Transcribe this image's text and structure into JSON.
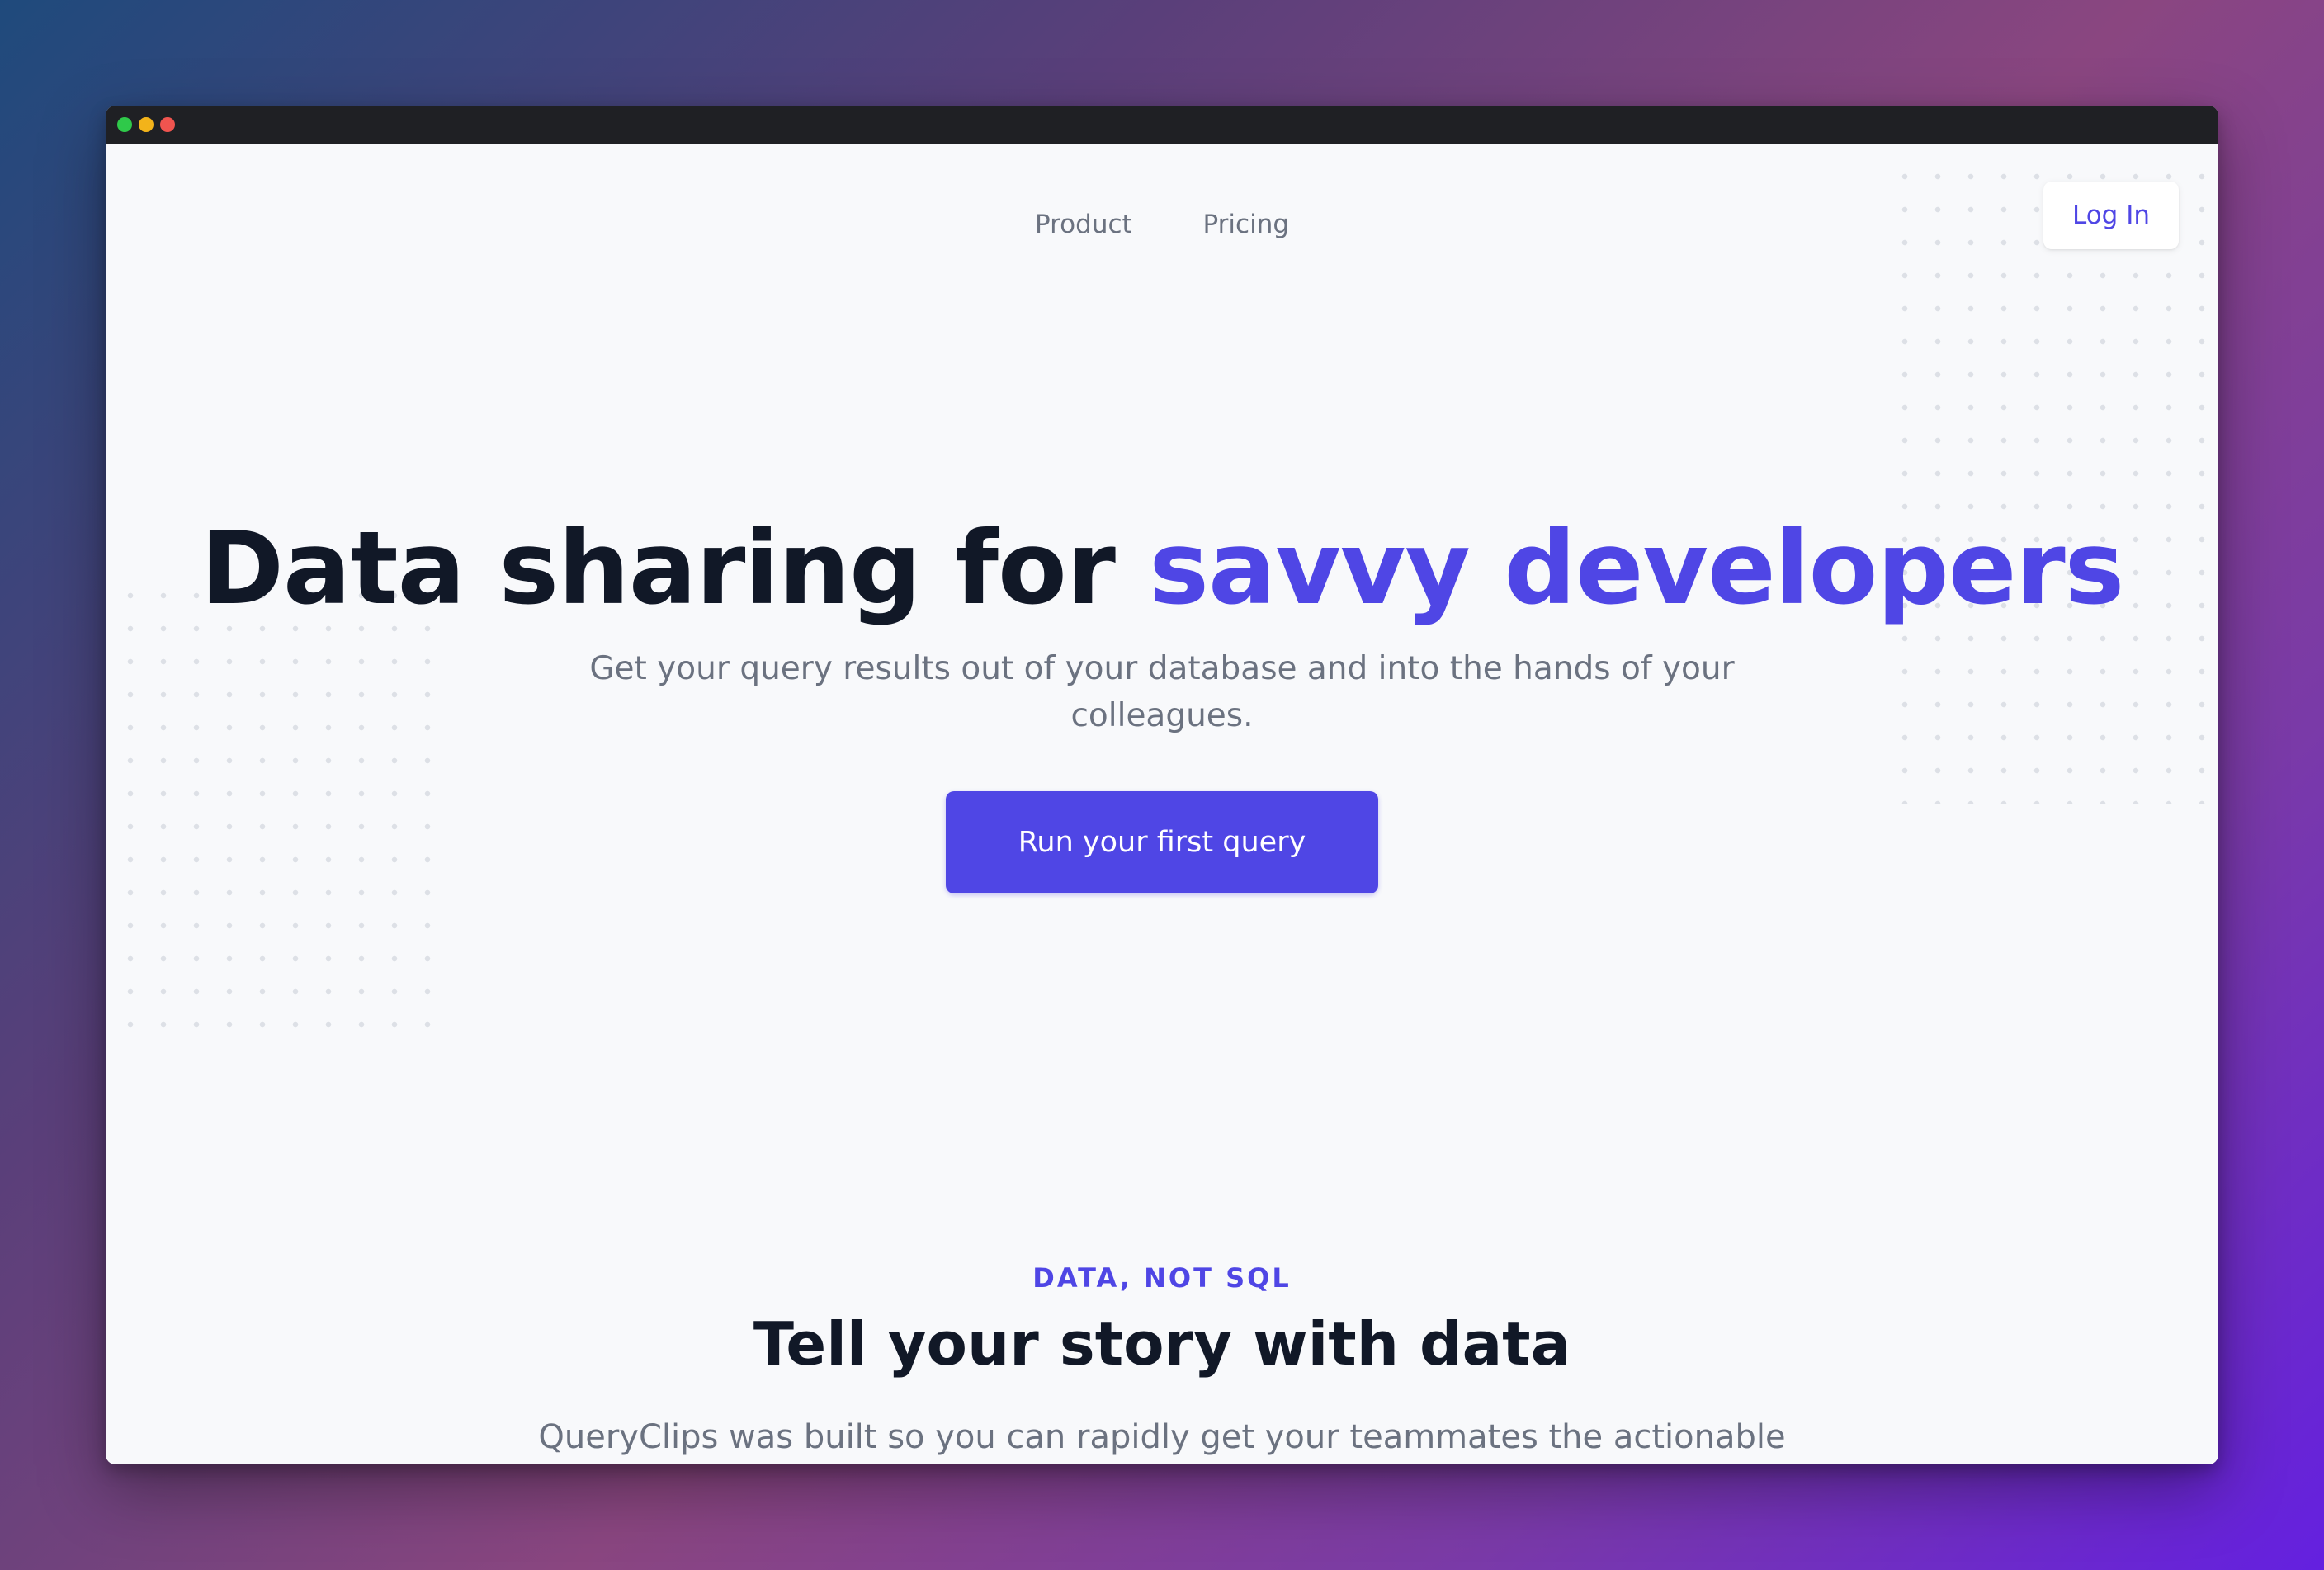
{
  "window": {
    "controls": [
      "green-dot",
      "yellow-dot",
      "red-dot"
    ]
  },
  "nav": {
    "links": [
      "Product",
      "Pricing"
    ],
    "login_label": "Log In"
  },
  "hero": {
    "title_main": "Data sharing for ",
    "title_accent": "savvy developers",
    "subtitle": "Get your query results out of your database and into the hands of your colleagues.",
    "cta_label": "Run your first query"
  },
  "section": {
    "eyebrow": "DATA, NOT SQL",
    "title": "Tell your story with data",
    "subtitle": "QueryClips was built so you can rapidly get your teammates the actionable insights they need to make decisions."
  },
  "colors": {
    "accent": "#4f46e5",
    "heading": "#111827",
    "muted": "#6b7280",
    "page_bg": "#f8f9fb",
    "titlebar": "#1f2024"
  }
}
